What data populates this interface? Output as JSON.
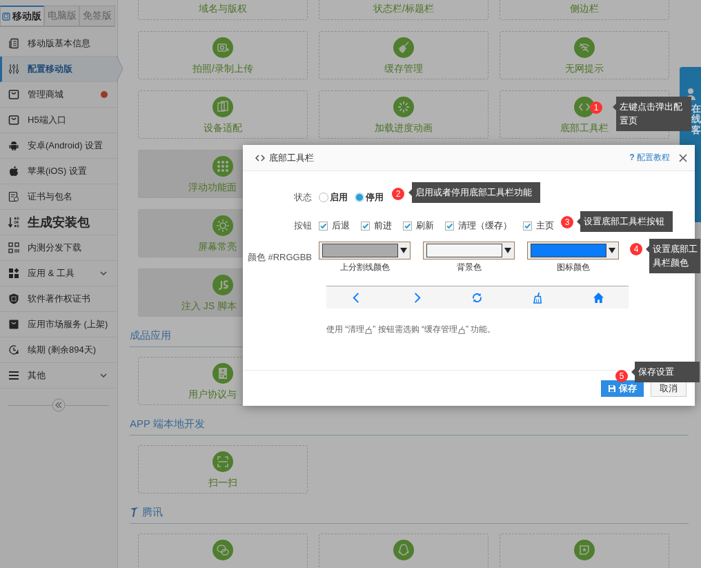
{
  "sidebar": {
    "tabs": [
      {
        "label": "移动版",
        "selected": true
      },
      {
        "label": "电脑版",
        "selected": false
      },
      {
        "label": "免签版",
        "selected": false
      }
    ],
    "items": [
      {
        "label": "移动版基本信息",
        "kind": "link",
        "selected": false,
        "dot": false
      },
      {
        "label": "配置移动版",
        "kind": "link",
        "selected": true,
        "dot": false
      },
      {
        "label": "管理商城",
        "kind": "link",
        "selected": false,
        "dot": true
      },
      {
        "label": "H5端入口",
        "kind": "link",
        "selected": false,
        "dot": false
      },
      {
        "label": "安卓(Android) 设置",
        "kind": "link",
        "selected": false,
        "dot": false
      },
      {
        "label": "苹果(iOS) 设置",
        "kind": "link",
        "selected": false,
        "dot": false
      },
      {
        "label": "证书与包名",
        "kind": "link",
        "selected": false,
        "dot": false
      },
      {
        "label": "生成安装包",
        "kind": "primary",
        "selected": false,
        "dot": false
      },
      {
        "label": "内测分发下载",
        "kind": "link",
        "selected": false,
        "dot": false
      },
      {
        "label": "应用 & 工具",
        "kind": "group",
        "selected": false,
        "dot": false,
        "expanded": false
      },
      {
        "label": "软件著作权证书",
        "kind": "link",
        "selected": false,
        "dot": false
      },
      {
        "label": "应用市场服务 (上架)",
        "kind": "link",
        "selected": false,
        "dot": false
      },
      {
        "label": "续期 (剩余894天)",
        "kind": "link",
        "selected": false,
        "dot": false
      },
      {
        "label": "其他",
        "kind": "group",
        "selected": false,
        "dot": false,
        "expanded": false
      }
    ]
  },
  "groups": [
    {
      "cards": [
        {
          "kind": "label",
          "label": "域名与版权",
          "disabled": false
        },
        {
          "kind": "label",
          "label": "状态栏/标题栏",
          "disabled": false
        },
        {
          "kind": "label",
          "label": "侧边栏",
          "disabled": false
        },
        {
          "kind": "icon",
          "label": "拍照/录制上传",
          "disabled": false
        },
        {
          "kind": "icon",
          "label": "缓存管理",
          "disabled": false
        },
        {
          "kind": "icon",
          "label": "无网提示",
          "disabled": false
        },
        {
          "kind": "icon",
          "label": "设备适配",
          "disabled": false
        },
        {
          "kind": "icon",
          "label": "加载进度动画",
          "disabled": false
        },
        {
          "kind": "icon",
          "label": "底部工具栏",
          "disabled": false
        },
        {
          "kind": "icon",
          "label": "浮动功能面",
          "disabled": true
        },
        {
          "kind": "icon",
          "label": "屏幕常亮",
          "disabled": true
        },
        {
          "kind": "icon",
          "label": "注入 JS 脚本",
          "disabled": true
        }
      ]
    },
    {
      "title": "成品应用",
      "cards": [
        {
          "kind": "icon",
          "label": "用户协议与",
          "disabled": false
        }
      ]
    },
    {
      "title": "APP 端本地开发",
      "cards": [
        {
          "kind": "icon",
          "label": "扫一扫",
          "disabled": false
        }
      ]
    },
    {
      "title": "腾讯",
      "cards": [
        {
          "kind": "icon",
          "disabled": false
        },
        {
          "kind": "icon",
          "disabled": false
        },
        {
          "kind": "icon",
          "disabled": false
        }
      ]
    }
  ],
  "service_tab": {
    "label": "在线客"
  },
  "dialog": {
    "title": "底部工具栏",
    "help_mark": "?",
    "help_link": "配置教程",
    "status": {
      "label": "状态",
      "options": [
        {
          "label": "启用",
          "selected": false
        },
        {
          "label": "停用",
          "selected": true
        }
      ]
    },
    "buttons": {
      "label": "按钮",
      "options": [
        {
          "label": "后退",
          "checked": true
        },
        {
          "label": "前进",
          "checked": true
        },
        {
          "label": "刷新",
          "checked": true
        },
        {
          "label": "清理（缓存）",
          "checked": true
        },
        {
          "label": "主页",
          "checked": true
        }
      ]
    },
    "colors": {
      "label": "颜色 #RRGGBB",
      "pickers": [
        {
          "caption": "上分割线颜色",
          "color": "#aaaaaa"
        },
        {
          "caption": "背景色",
          "color": "#f5f5f5"
        },
        {
          "caption": "图标颜色",
          "color": "#0a7cf9"
        }
      ]
    },
    "note": [
      "使用 “清理 ",
      "” 按钮需选购 “缓存管理 ",
      "” 功能。"
    ],
    "save": "保存",
    "cancel": "取消"
  },
  "callouts": [
    {
      "number": "1",
      "text": "左键点击弹出配置页"
    },
    {
      "number": "2",
      "text": "启用或者停用底部工具栏功能"
    },
    {
      "number": "3",
      "text": "设置底部工具栏按钮"
    },
    {
      "number": "4",
      "text": "设置底部工具栏颜色"
    },
    {
      "number": "5",
      "text": "保存设置"
    }
  ]
}
